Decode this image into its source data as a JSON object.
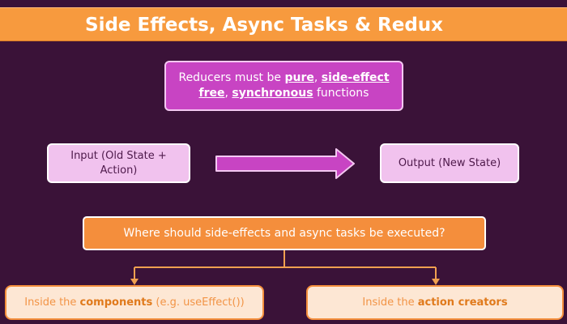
{
  "title": "Side Effects, Async Tasks & Redux",
  "reducer_note": {
    "prefix": "Reducers must be ",
    "pure": "pure",
    "comma1": ", ",
    "side_effect_free": "side-effect free",
    "comma2": ", ",
    "synchronous": "synchronous",
    "suffix": " functions"
  },
  "input_box": "Input (Old State + Action)",
  "output_box": "Output (New State)",
  "question": "Where should side-effects and async tasks be executed?",
  "answer_left": {
    "prefix": "Inside the ",
    "highlight": "components",
    "suffix": " (e.g. useEffect())"
  },
  "answer_right": {
    "prefix": "Inside the ",
    "highlight": "action creators"
  },
  "colors": {
    "background": "#3a1238",
    "title_bar": "#f79a3e",
    "reducer_box": "#c844c3",
    "light_pink": "#f1c2ee",
    "orange": "#f48e3c",
    "answer_bg": "#fde7d4",
    "arrow": "#c844c3",
    "connector": "#f0a050"
  }
}
